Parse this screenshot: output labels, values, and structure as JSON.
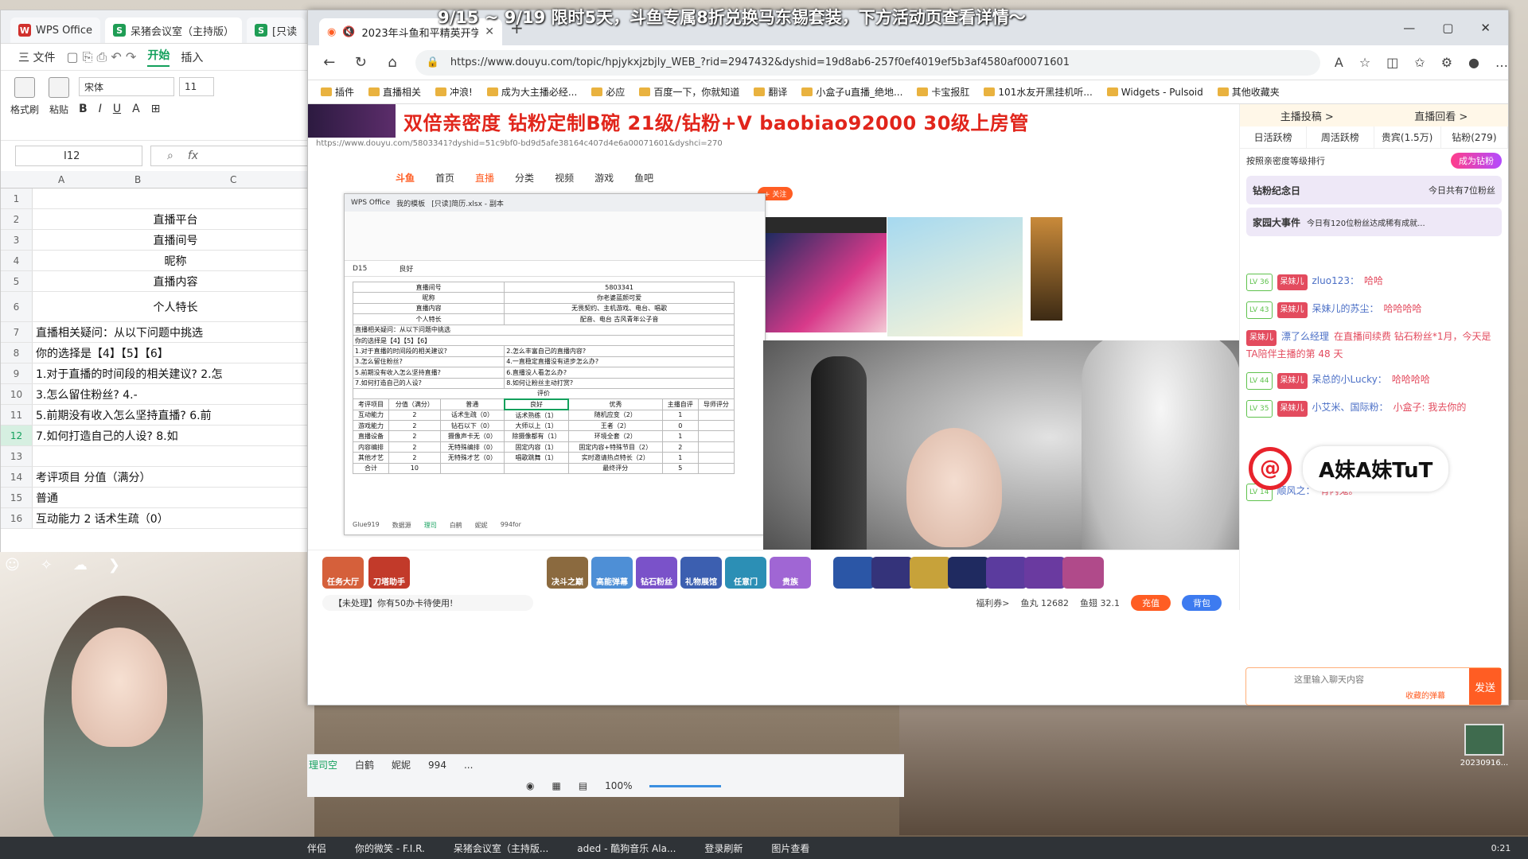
{
  "ticker": "9/15 ~ 9/19 限时5天，斗鱼专属8折兑换马东锡套装，下方活动页查看详情～",
  "wps": {
    "tabs": [
      "WPS Office",
      "呆猪会议室（主持版）",
      "[只读"
    ],
    "menu": [
      "三 文件",
      "开始",
      "插入"
    ],
    "active_menu": "开始",
    "ribbon": {
      "format_painter": "格式刷",
      "paste": "粘贴",
      "font": "宋体",
      "size": "11"
    },
    "namebox": "I12",
    "fx": "fx",
    "columns": [
      "A",
      "B",
      "C"
    ],
    "rows": [
      {
        "n": "1",
        "text": ""
      },
      {
        "n": "2",
        "text": "直播平台",
        "center": true
      },
      {
        "n": "3",
        "text": "直播间号",
        "center": true
      },
      {
        "n": "4",
        "text": "昵称",
        "center": true
      },
      {
        "n": "5",
        "text": "直播内容",
        "center": true
      },
      {
        "n": "6",
        "text": "个人特长",
        "center": true
      },
      {
        "n": "7",
        "text": "直播相关疑问：从以下问题中挑选"
      },
      {
        "n": "8",
        "text": "你的选择是【4】【5】【6】"
      },
      {
        "n": "9",
        "text": "1.对于直播的时间段的相关建议?          2.怎"
      },
      {
        "n": "10",
        "text": "3.怎么留住粉丝?                                   4.-"
      },
      {
        "n": "11",
        "text": "5.前期没有收入怎么坚持直播?               6.前"
      },
      {
        "n": "12",
        "text": "7.如何打造自己的人设?                        8.如"
      },
      {
        "n": "13",
        "text": ""
      },
      {
        "n": "14",
        "text": "考评项目     分值（满分）"
      },
      {
        "n": "15",
        "text": "                                                普通"
      },
      {
        "n": "16",
        "text": "互动能力              2        话术生疏（0）"
      }
    ],
    "selected_row": "12",
    "sheets": [
      "理司空",
      "白鹤",
      "妮妮",
      "994",
      "..."
    ],
    "zoom": "100%"
  },
  "browser": {
    "tab_title": "2023年斗鱼和平精英开学季",
    "url": "https://www.douyu.com/topic/hpjykxjzbjly_WEB_?rid=2947432&dyshid=19d8ab6-257f0ef4019ef5b3af4580af00071601",
    "bookmarks": [
      "插件",
      "直播相关",
      "冲浪!",
      "成为大主播必经...",
      "必应",
      "百度一下，你就知道",
      "翻译",
      "小盒子u直播_绝地...",
      "卡宝报肛",
      "101水友开黑挂机听...",
      "Widgets - Pulsoid",
      "其他收藏夹"
    ]
  },
  "banner": "双倍亲密度 钻粉定制B碗 21级/钻粉+V baobiao92000 30级上房管",
  "inner": {
    "url": "https://www.douyu.com/5803341?dyshid=51c9bf0-bd9d5afe38164c407d4e6a00071601&dyshci=270",
    "nav": [
      "首页",
      "直播",
      "分类",
      "视频",
      "游戏",
      "鱼吧"
    ],
    "nav_active": "直播"
  },
  "nested": {
    "title_tabs": [
      "WPS Office",
      "我的模板",
      "[只读]简历.xlsx - 副本"
    ],
    "cell_ref": "D15",
    "cell_value": "良好",
    "rows": [
      [
        "直播间号",
        "5803341"
      ],
      [
        "昵称",
        "你老婆蓝颜可爱"
      ],
      [
        "直播内容",
        "无畏契约、主机游戏、电台、唱歌"
      ],
      [
        "个人特长",
        "配音、电台 古风青年公子音"
      ]
    ],
    "questions": "直播相关疑问：从以下问题中挑选",
    "choice": "你的选择是【4】【5】【6】",
    "q": [
      [
        "1.对于直播的时间段的相关建议?",
        "2.怎么丰富自己的直播内容?"
      ],
      [
        "3.怎么留住粉丝?",
        "4.一直稳定直播没有进步怎么办?"
      ],
      [
        "5.前期没有收入怎么坚持直播?",
        "6.直播没人看怎么办?"
      ],
      [
        "7.如何打造自己的人设?",
        "8.如何让粉丝主动打赏?"
      ]
    ],
    "eval_title": "评价",
    "header": [
      "考评项目",
      "分值（满分）",
      "普通",
      "良好",
      "优秀",
      "主播自评",
      "导师评分"
    ],
    "sub_header": "评分说明",
    "table": [
      [
        "互动能力",
        "2",
        "话术生疏（0）",
        "话术熟练（1）",
        "随机应变（2）",
        "1",
        ""
      ],
      [
        "游戏能力",
        "2",
        "钻石以下（0）",
        "大师以上（1）",
        "王者（2）",
        "0",
        ""
      ],
      [
        "直播设备",
        "2",
        "摄像声卡无（0）",
        "除摄像都有（1）",
        "环境全套（2）",
        "1",
        ""
      ],
      [
        "内容编排",
        "2",
        "无特殊编排（0）",
        "固定内容（1）",
        "固定内容+特殊节目（2）",
        "2",
        ""
      ],
      [
        "其他才艺",
        "2",
        "无特殊才艺（0）",
        "唱歌跳舞（1）",
        "实时邀请热点特长（2）",
        "1",
        ""
      ],
      [
        "合计",
        "10",
        "",
        "",
        "最终评分",
        "5",
        ""
      ]
    ],
    "sheets": [
      "Glue919",
      "数据源",
      "理司",
      "白鹤",
      "妮妮",
      "994for"
    ],
    "zoom": "100%"
  },
  "gifts": [
    "任务大厅",
    "刀塔助手",
    "决斗之巅",
    "高能弹幕",
    "钻石粉丝",
    "礼物展馆",
    "任意门",
    "贵族"
  ],
  "notice": "【未处理】你有50办卡待使用!",
  "stats": {
    "welfare": "福利券>",
    "fish_ball": "鱼丸 12682",
    "fish_wing": "鱼翅 32.1",
    "recharge": "充值",
    "bag": "背包"
  },
  "chat": {
    "head": [
      "主播投稿 >",
      "直播回看 >"
    ],
    "tabs": [
      "日活跃榜",
      "周活跃榜",
      "贵宾(1.5万)",
      "钻粉(279)"
    ],
    "rank_text": "按照亲密度等级排行",
    "vip_btn": "成为钻粉",
    "card1": {
      "title": "钻粉纪念日",
      "right": "今日共有7位粉丝"
    },
    "card2": {
      "title": "家园大事件",
      "right": "今日有120位粉丝达成稀有成就..."
    },
    "lines": [
      {
        "lv": "LV 36",
        "fan": "呆妹儿",
        "user": "zluo123：",
        "msg": "哈哈"
      },
      {
        "lv": "LV 43",
        "fan": "呆妹儿",
        "user": "呆妹儿的苏尘：",
        "msg": "哈哈哈哈"
      },
      {
        "lv": "",
        "fan": "呆妹儿",
        "user": "漂了么经理",
        "msg": "在直播间续费 钻石粉丝*1月，今天是TA陪伴主播的第 48 天"
      },
      {
        "lv": "LV 44",
        "fan": "呆妹儿",
        "user": "呆总的小Lucky：",
        "msg": "哈哈哈哈"
      },
      {
        "lv": "LV 35",
        "fan": "呆妹儿",
        "user": "小艾米、国际粉：",
        "msg": "小盒子: 我去你的"
      },
      {
        "lv": "LV 14",
        "fan": "",
        "user": "顺风之：",
        "msg": "有内鬼。"
      }
    ],
    "overlay_name": "A妹A妹TuT",
    "input_placeholder": "这里输入聊天内容",
    "danmu_tag": "收藏的弹幕",
    "send": "发送"
  },
  "taskbar": [
    "伴侣",
    "你的微笑 - F.I.R.",
    "呆猪会议室（主持版...",
    "aded - 酷狗音乐 Ala...",
    "登录刷新",
    "图片查看"
  ],
  "clock": "0:21",
  "side_label": "20230916..."
}
